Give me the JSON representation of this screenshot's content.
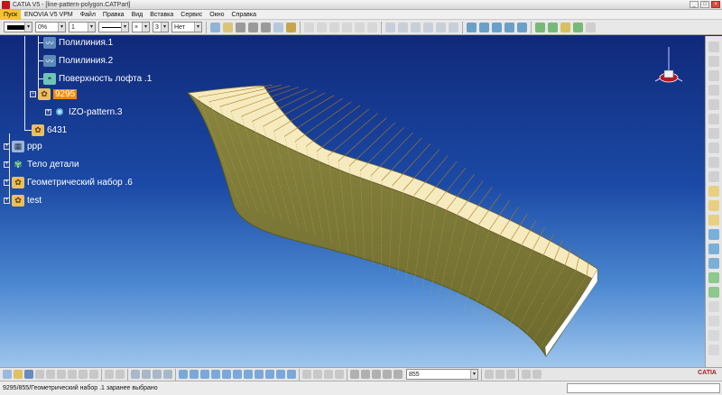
{
  "window": {
    "title": "CATIA V5 - [line-pattern-polygon.CATPart]",
    "controls": [
      "_",
      "□",
      "×"
    ]
  },
  "menu": [
    "Пуск",
    "ENOVIA V5 VPM",
    "Файл",
    "Правка",
    "Вид",
    "Вставка",
    "Сервис",
    "Окно",
    "Справка"
  ],
  "graphic_properties": {
    "fill_color": "#000000",
    "transparency": "0%",
    "line_width": "1",
    "point_symbol": "×",
    "layer_number": "3",
    "layer": "Нет"
  },
  "tree": {
    "nodes": [
      {
        "label": "Полилиния.1",
        "icon": "polyline-icon"
      },
      {
        "label": "Полилиния.2",
        "icon": "polyline-icon"
      },
      {
        "label": "Поверхность лофта .1",
        "icon": "loft-surface-icon"
      },
      {
        "label": "9295",
        "icon": "hybrid-body-icon",
        "selected": true
      },
      {
        "label": "IZO-pattern.3",
        "icon": "pattern-icon"
      },
      {
        "label": "6431",
        "icon": "hybrid-body-icon"
      },
      {
        "label": "ppp",
        "icon": "sketch-icon"
      },
      {
        "label": "Тело детали",
        "icon": "part-body-icon"
      },
      {
        "label": "Геометрический набор .6",
        "icon": "geometric-set-icon"
      },
      {
        "label": "test",
        "icon": "geometric-set-icon"
      }
    ]
  },
  "bottom_toolbar": {
    "input_value": "855"
  },
  "brand": "CATIA",
  "status": {
    "text": "9295/855/Геометрический набор .1 заранее выбрано"
  },
  "colors": {
    "viewport_top": "#10297a",
    "viewport_bottom": "#9ec6ee",
    "surface": "#7d7a3a",
    "surface_top": "#f7ecc4",
    "selection": "#f08a10",
    "menu_active": "#f4c430"
  }
}
